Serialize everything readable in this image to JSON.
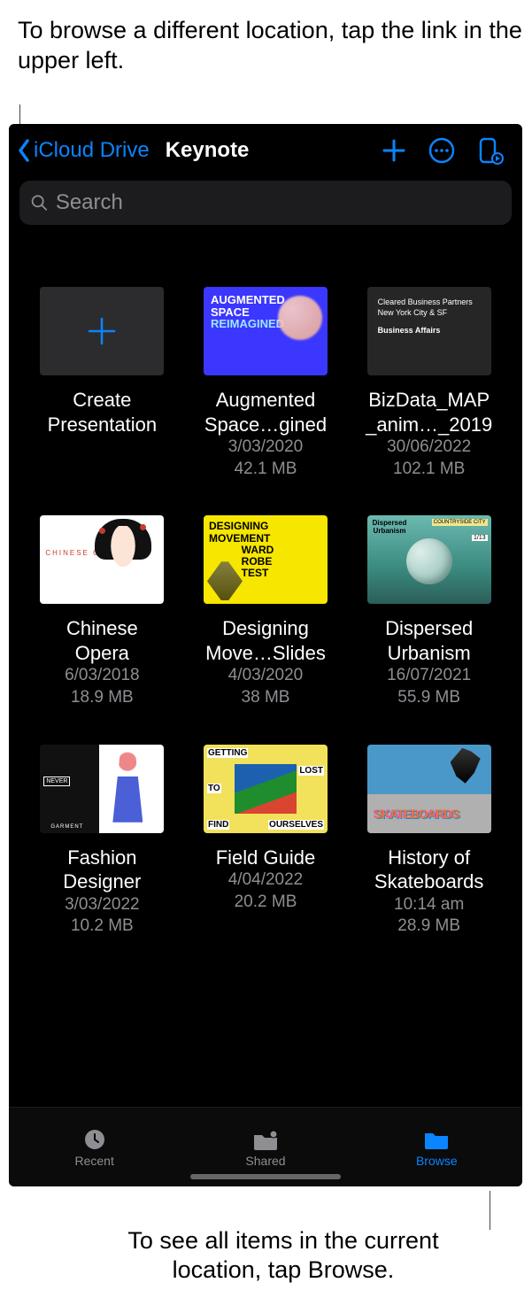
{
  "callouts": {
    "top": "To browse a different location, tap the link in the upper left.",
    "bottom": "To see all items in the current location, tap Browse."
  },
  "nav": {
    "back_label": "iCloud Drive",
    "title": "Keynote"
  },
  "search": {
    "placeholder": "Search"
  },
  "create": {
    "line1": "Create",
    "line2": "Presentation"
  },
  "files": [
    {
      "name1": "Augmented",
      "name2": "Space…gined",
      "date": "3/03/2020",
      "size": "42.1 MB",
      "thumb_line1": "AUGMENTED",
      "thumb_line2": "SPACE",
      "thumb_line3": "REIMAGINED"
    },
    {
      "name1": "BizData_MAP",
      "name2": "_anim…_2019",
      "date": "30/06/2022",
      "size": "102.1 MB",
      "thumb_line1": "Cleared Business Partners",
      "thumb_line2": "New York City & SF",
      "thumb_line3": "Business Affairs"
    },
    {
      "name1": "Chinese",
      "name2": "Opera",
      "date": "6/03/2018",
      "size": "18.9 MB",
      "thumb_label": "CHINESE OPERA"
    },
    {
      "name1": "Designing",
      "name2": "Move…Slides",
      "date": "4/03/2020",
      "size": "38 MB",
      "thumb_text": "DESIGNING\nMOVEMENT\n           WARD\n           ROBE\n           TEST"
    },
    {
      "name1": "Dispersed",
      "name2": "Urbanism",
      "date": "16/07/2021",
      "size": "55.9 MB",
      "thumb_label": "Dispersed\nUrbanism",
      "thumb_tags": "COUNTRYSIDE  CITY",
      "thumb_page": "1/13"
    },
    {
      "name1": "Fashion",
      "name2": "Designer",
      "date": "3/03/2022",
      "size": "10.2 MB",
      "thumb_never": "NEVER",
      "thumb_garm": "GARMENT"
    },
    {
      "name1": "Field Guide",
      "name2": "",
      "date": "4/04/2022",
      "size": "20.2 MB",
      "thumb_words": [
        "GETTING",
        "LOST",
        "TO",
        "FIND",
        "OURSELVES"
      ]
    },
    {
      "name1": "History of",
      "name2": "Skateboards",
      "date": "10:14 am",
      "size": "28.9 MB",
      "thumb_graffiti": "SKATEBOARDS"
    }
  ],
  "tabs": {
    "recent": "Recent",
    "shared": "Shared",
    "browse": "Browse"
  }
}
